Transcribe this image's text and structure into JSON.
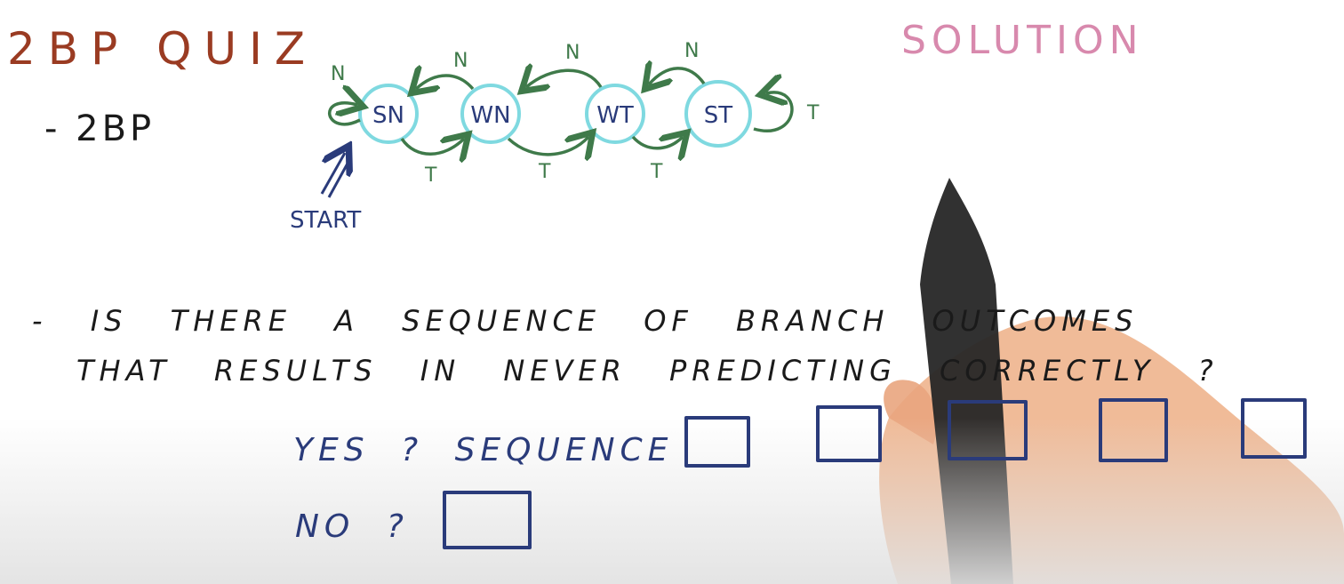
{
  "header": {
    "title": "2BP QUIZ",
    "solution_label": "SOLUTION"
  },
  "bullet": "- 2BP",
  "diagram": {
    "states": [
      "SN",
      "WN",
      "WT",
      "ST"
    ],
    "not_taken_label": "N",
    "taken_label": "T",
    "start_label": "START"
  },
  "question": {
    "line1": "- IS THERE A SEQUENCE OF BRANCH OUTCOMES",
    "line2": "THAT RESULTS IN NEVER PREDICTING CORRECTLY ?"
  },
  "answers": {
    "yes_label": "YES ? SEQUENCE",
    "no_label": "NO ?"
  },
  "colors": {
    "title": "#9a3b22",
    "solution": "#d889ad",
    "state_circle": "#7fd9e0",
    "arrow": "#3f7a4a",
    "ink_navy": "#2a3b7a",
    "ink_black": "#1a1a1a"
  }
}
